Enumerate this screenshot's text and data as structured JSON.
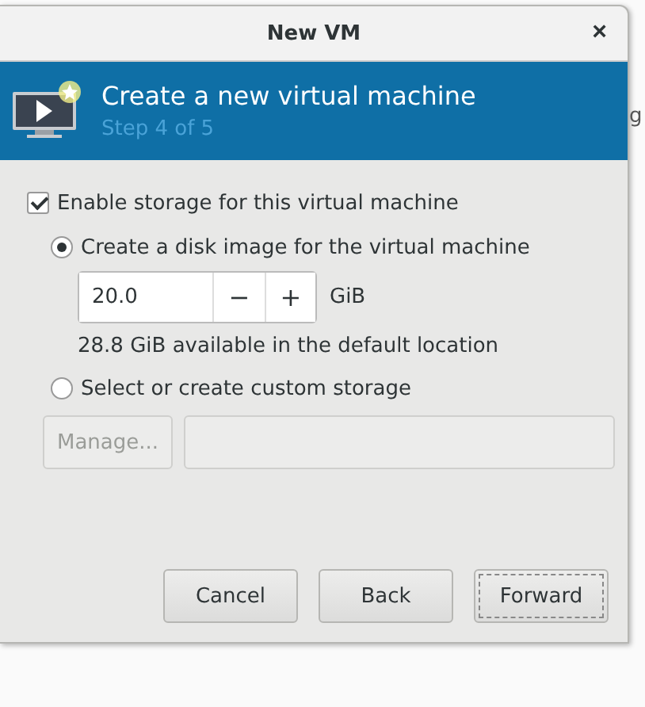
{
  "window": {
    "title": "New VM",
    "close": "×"
  },
  "header": {
    "title": "Create a new virtual machine",
    "subtitle": "Step 4 of 5"
  },
  "enable_storage": {
    "label": "Enable storage for this virtual machine",
    "checked": true
  },
  "options": [
    {
      "kind": "disk",
      "label": "Create a disk image for the virtual machine",
      "selected": true,
      "size": {
        "value": "20.0",
        "minus": "−",
        "plus": "+",
        "unit": "GiB"
      },
      "info": "28.8 GiB available in the default location"
    },
    {
      "kind": "custom",
      "label": "Select or create custom storage",
      "selected": false,
      "manage_button": {
        "label": "Manage...",
        "disabled": true
      },
      "path_field": {
        "disabled": true
      }
    }
  ],
  "buttons": [
    {
      "label": "Cancel",
      "focused": false
    },
    {
      "label": "Back",
      "focused": false
    },
    {
      "label": "Forward",
      "focused": true
    }
  ],
  "background": {
    "text": "g"
  }
}
